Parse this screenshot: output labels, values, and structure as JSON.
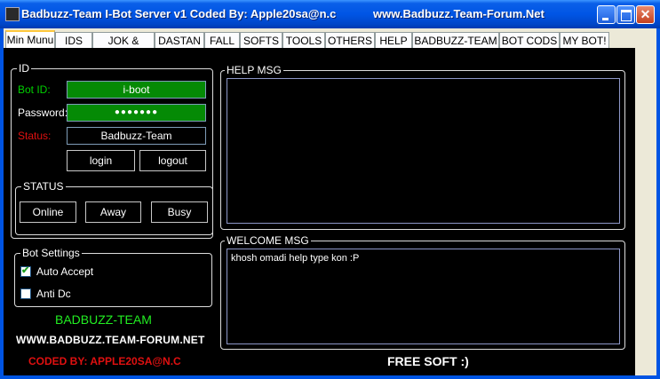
{
  "window": {
    "title": "Badbuzz-Team I-Bot Server v1 Coded By: Apple20sa@n.c",
    "title_url": "www.Badbuzz.Team-Forum.Net",
    "minimize_label": "",
    "close_label": "✕"
  },
  "tabs": [
    {
      "label": "Min Munu"
    },
    {
      "label": "IDS"
    },
    {
      "label": "JOK & LOVE"
    },
    {
      "label": "DASTAN"
    },
    {
      "label": "FALL"
    },
    {
      "label": "SOFTS"
    },
    {
      "label": "TOOLS"
    },
    {
      "label": "OTHERS"
    },
    {
      "label": "HELP"
    },
    {
      "label": "BADBUZZ-TEAM"
    },
    {
      "label": "BOT CODS"
    },
    {
      "label": "MY BOT!"
    }
  ],
  "id_group": {
    "legend": "ID",
    "bot_id_label": "Bot ID:",
    "bot_id_value": "i-boot",
    "password_label": "Password:",
    "password_value": "●●●●●●●",
    "status_label": "Status:",
    "status_value": "Badbuzz-Team",
    "login_label": "login",
    "logout_label": "logout"
  },
  "status_group": {
    "legend": "STATUS",
    "online_label": "Online",
    "away_label": "Away",
    "busy_label": "Busy"
  },
  "bot_settings": {
    "legend": "Bot Settings",
    "auto_accept_label": "Auto Accept",
    "auto_accept_checked": true,
    "anti_dc_label": "Anti Dc",
    "anti_dc_checked": false
  },
  "branding": {
    "team": "BADBUZZ-TEAM",
    "site": "WWW.BADBUZZ.TEAM-FORUM.NET",
    "coded_by": "CODED BY: APPLE20SA@N.C"
  },
  "help_msg": {
    "legend": "HELP MSG",
    "content": ""
  },
  "welcome_msg": {
    "legend": "WELCOME MSG",
    "content": "khosh omadi help type kon :P"
  },
  "free_soft": "FREE SOFT :)",
  "colors": {
    "green_field": "#058a05",
    "green_text": "#00d000",
    "red_text": "#e01010",
    "bright_green": "#22ee22"
  }
}
